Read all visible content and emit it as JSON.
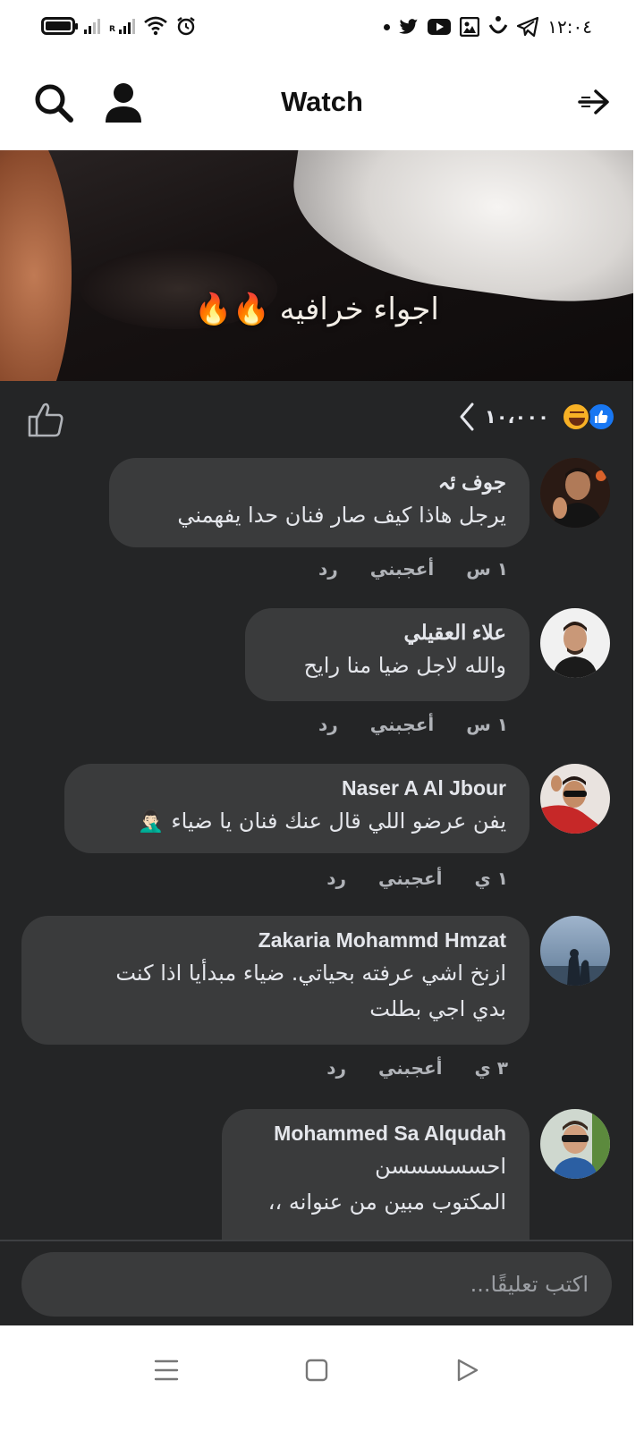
{
  "status_bar": {
    "time": "١٢:٠٤",
    "left_icons": [
      "battery-icon",
      "signal-icon",
      "signal-roaming-icon",
      "wifi-icon",
      "alarm-icon"
    ],
    "right_icons": [
      "notification-dot",
      "twitter-icon",
      "youtube-icon",
      "app-icon",
      "app-icon",
      "telegram-icon"
    ]
  },
  "header": {
    "title": "Watch"
  },
  "video": {
    "caption": "اجواء خرافيه 🔥🔥"
  },
  "reactions": {
    "count": "١٠،٠٠٠"
  },
  "comments": [
    {
      "name": "جوف ئہ",
      "text": "يرجل هاذا كيف صار فنان حدا يفهمني",
      "time": "١ س",
      "like": "أعجبني",
      "reply": "رد"
    },
    {
      "name": "علاء العقيلي",
      "text": "والله لاجل ضيا منا رايح",
      "time": "١ س",
      "like": "أعجبني",
      "reply": "رد"
    },
    {
      "name": "Naser A Al Jbour",
      "text": "يفن عرضو اللي قال عنك فنان يا ضياء 🤦🏻‍♂️",
      "time": "١ ي",
      "like": "أعجبني",
      "reply": "رد"
    },
    {
      "name": "Zakaria Mohammd Hmzat",
      "text_line1": "ازنخ اشي عرفته بحياتي. ضياء مبدأيا اذا كنت",
      "text_line2": "بدي اجي بطلت",
      "time": "٣ ي",
      "like": "أعجبني",
      "reply": "رد"
    },
    {
      "name": "Mohammed Sa Alqudah",
      "text_line1": "احسسسسسن",
      "text_line2": "المكتوب مبين من عنوانه ،،"
    }
  ],
  "composer": {
    "placeholder": "اكتب تعليقًا..."
  },
  "colors": {
    "dark_bg": "#242526",
    "bubble": "#3a3b3c",
    "text": "#e4e6eb",
    "meta": "#b0b3b8",
    "like_blue": "#1877f2"
  }
}
